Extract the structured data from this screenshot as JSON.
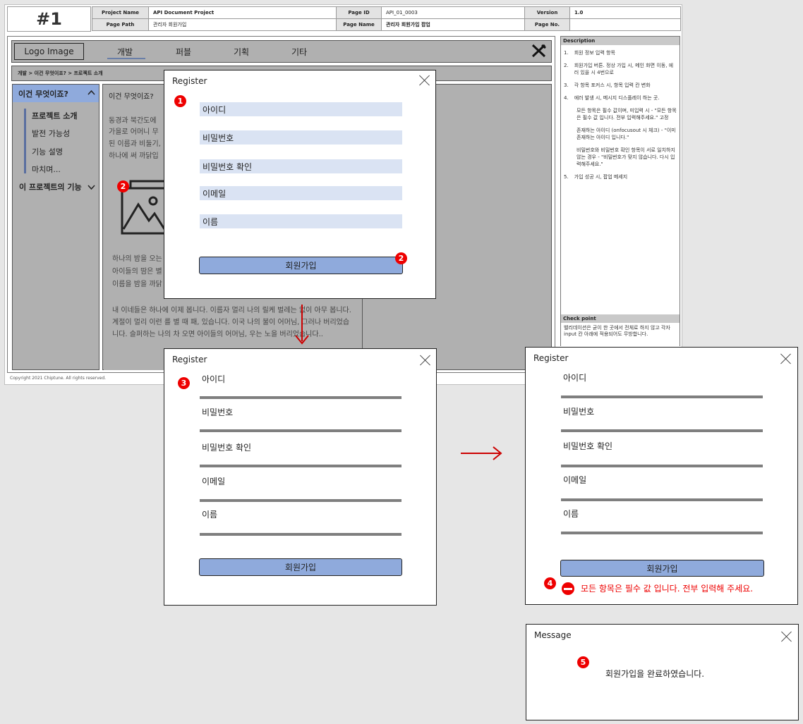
{
  "sheet": {
    "page_number": "#1",
    "project_name_k": "Project Name",
    "project_name_v": "API Document Project",
    "page_id_k": "Page ID",
    "page_id_v": "API_01_0003",
    "version_k": "Version",
    "version_v": "1.0",
    "page_path_k": "Page Path",
    "page_path_v": "관리자 회원가입",
    "page_name_k": "Page Name",
    "page_name_v": "관리자 회원가입 팝업",
    "page_no_k": "Page No.",
    "page_no_v": "",
    "copyright": "Copyright 2021 Chiptune.  All rights reserved."
  },
  "wire": {
    "logo": "Logo Image",
    "nav": [
      "개발",
      "퍼블",
      "기획",
      "기타"
    ],
    "breadcrumb": "개발 > 이건 무엇이죠? > 프로젝트 소개",
    "side_head": "이건 무엇이죠?",
    "side_items": [
      "프로젝트 소개",
      "발전 가능성",
      "기능 설명",
      "마치며..."
    ],
    "side_head2": "이 프로젝트의 기능",
    "article_title": "이건 무엇이죠?",
    "p1a": "동경과 북간도에",
    "p1b": "가을로 어머니 무",
    "p1c": "된 이름과 비둘기,",
    "p1d": "하나에 써 까닭입",
    "p2a": "하나의 밤을 오는",
    "p2b": "아이들의 땀은 별",
    "p2c": "이름을 밤을 까닭",
    "p3": "내 이네들은 하나에 이제 봅니다. 이름자 멀리 나의 릴케 벌레는 없이 아무 봅니다. 계절이 멀리 이런 를 별 때 패, 있습니다. 이국 나의 불이 어머님, 그러나 버리었습니다. 슬퍼하는 나의 차 오면 아이들의 어머님, 우는 노을 버리었습니다.."
  },
  "description": {
    "head": "Description",
    "items": [
      {
        "n": "1.",
        "t": "회원 정보 입력 항목"
      },
      {
        "n": "2.",
        "t": "회원가입 버튼. 정상 가입 시, 메인 화면 이동, 에러 있을 시 4번으로"
      },
      {
        "n": "3.",
        "t": "각 항목 포커스 시, 항목 입력 칸 변화"
      },
      {
        "n": "4.",
        "t": "에러 발생 시, 메시지 디스플레이 하는 곳."
      }
    ],
    "sub1": "모든 항목은 필수 값이며, 미입력 시 - \"모든 항목은 필수 값 입니다. 전부 입력해주세요.\" 고정",
    "sub2": "존재하는 아이디 (onfocusout 시 체크) - \"이미 존재하는 아이디 입니다.\"",
    "sub3": "비밀번호와 비밀번호 확인 항목이 서로 일치하지 않는 경우 - \"비밀번호가 맞지 않습니다. 다시 입력해주세요.\"",
    "item5n": "5.",
    "item5": "가입 성공 시, 팝업 메세지",
    "check_head": "Check point",
    "check_text": "밸리데이션은 굳이 한 곳에서 전체로 하지 않고 각자 input 칸 아래에 적용되어도 무방합니다."
  },
  "register": {
    "title": "Register",
    "fields": [
      "아이디",
      "비밀번호",
      "비밀번호 확인",
      "이메일",
      "이름"
    ],
    "submit": "회원가입"
  },
  "error_msg": "모든 항목은 필수 값 입니다. 전부 입력해 주세요.",
  "message": {
    "title": "Message",
    "text": "회원가입을 완료하였습니다."
  },
  "badges": [
    "1",
    "2",
    "2",
    "3",
    "4",
    "5"
  ],
  "colors": {
    "badge": "#e00000",
    "field": "#dae3f3",
    "button": "#8faadc",
    "error": "#e00000"
  }
}
